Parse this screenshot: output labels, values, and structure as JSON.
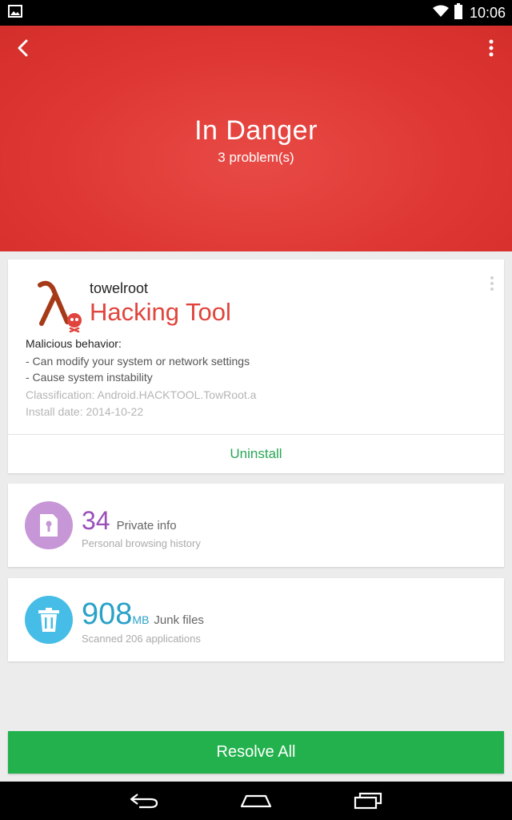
{
  "status_bar": {
    "time": "10:06",
    "icons": [
      "image-notification-icon",
      "wifi-icon",
      "battery-icon"
    ]
  },
  "header": {
    "title": "In Danger",
    "subtitle": "3 problem(s)",
    "color": "#de3632"
  },
  "threat": {
    "app_name": "towelroot",
    "type": "Hacking Tool",
    "behavior_heading": "Malicious behavior:",
    "behaviors": [
      "- Can modify your system or network settings",
      "- Cause system instability"
    ],
    "classification": "Classification: Android.HACKTOOL.TowRoot.a",
    "install_date": "Install date: 2014-10-22",
    "action_label": "Uninstall",
    "type_color": "#e0443c",
    "action_color": "#27a655"
  },
  "privacy": {
    "count": "34",
    "label": "Private info",
    "detail": "Personal browsing history",
    "color": "#9b4fb8",
    "icon": "lock-file-icon"
  },
  "junk": {
    "size": "908",
    "unit": "MB",
    "label": "Junk files",
    "detail": "Scanned 206 applications",
    "color": "#2aa1c8",
    "icon": "trash-icon"
  },
  "resolve_label": "Resolve All",
  "resolve_color": "#22b14c",
  "nav": [
    "back-icon",
    "home-icon",
    "recents-icon"
  ]
}
